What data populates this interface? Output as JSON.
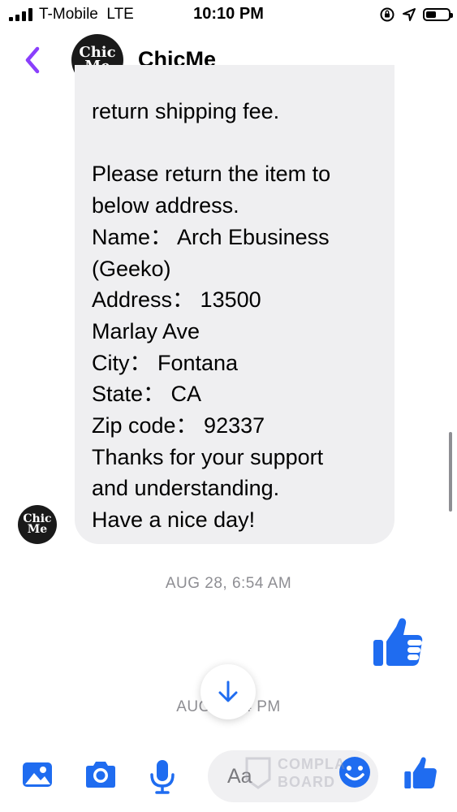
{
  "status_bar": {
    "carrier": "T-Mobile",
    "network": "LTE",
    "time": "10:10 PM",
    "battery_level": 0.45
  },
  "header": {
    "contact_name": "ChicMe",
    "avatar_text_top": "Chic",
    "avatar_text_bottom": "Me",
    "accent_color": "#8a3ffc"
  },
  "message": {
    "sender_avatar_top": "Chic",
    "sender_avatar_bottom": "Me",
    "text": "return shipping fee.\n\nPlease return the item to\nbelow address.\nName： Arch Ebusiness\n(Geeko)\nAddress： 13500\nMarlay Ave\nCity： Fontana\nState： CA\nZip code： 92337\nThanks for your support\nand understanding.\nHave a nice day!"
  },
  "timestamps": {
    "first": "AUG 28, 6:54 AM",
    "second": "AUG 2   .04 PM"
  },
  "composer": {
    "placeholder": "Aa",
    "icons": [
      "image-icon",
      "camera-icon",
      "microphone-icon",
      "emoji-icon",
      "thumbs-up-icon"
    ],
    "icon_color": "#1f6cf0"
  },
  "watermark": {
    "line1": "COMPLA",
    "line2": "BOARD"
  }
}
